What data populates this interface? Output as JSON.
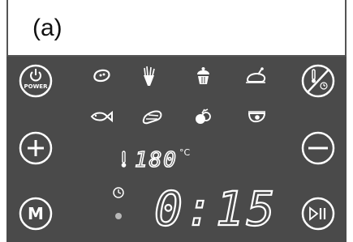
{
  "caption": "(a)",
  "colors": {
    "panel": "#4a4a4a",
    "glyph": "#ffffff",
    "dot": "#b8b8b8"
  },
  "buttons": {
    "power": {
      "label": "POWER",
      "icon": "power-icon"
    },
    "temp_timer": {
      "icon": "thermometer-timer-icon"
    },
    "plus": {
      "icon": "plus-icon"
    },
    "minus": {
      "icon": "minus-icon"
    },
    "menu": {
      "label": "M",
      "icon": "menu-icon"
    },
    "start_pause": {
      "icon": "play-pause-icon"
    }
  },
  "presets": [
    {
      "icon": "steak-icon"
    },
    {
      "icon": "fries-icon"
    },
    {
      "icon": "cupcake-icon"
    },
    {
      "icon": "chicken-icon"
    },
    {
      "icon": "fish-icon"
    },
    {
      "icon": "ribs-icon"
    },
    {
      "icon": "vegetables-icon"
    },
    {
      "icon": "shrimp-icon"
    }
  ],
  "display": {
    "temperature": "180",
    "temperature_unit": "°C",
    "time": "0:15"
  }
}
